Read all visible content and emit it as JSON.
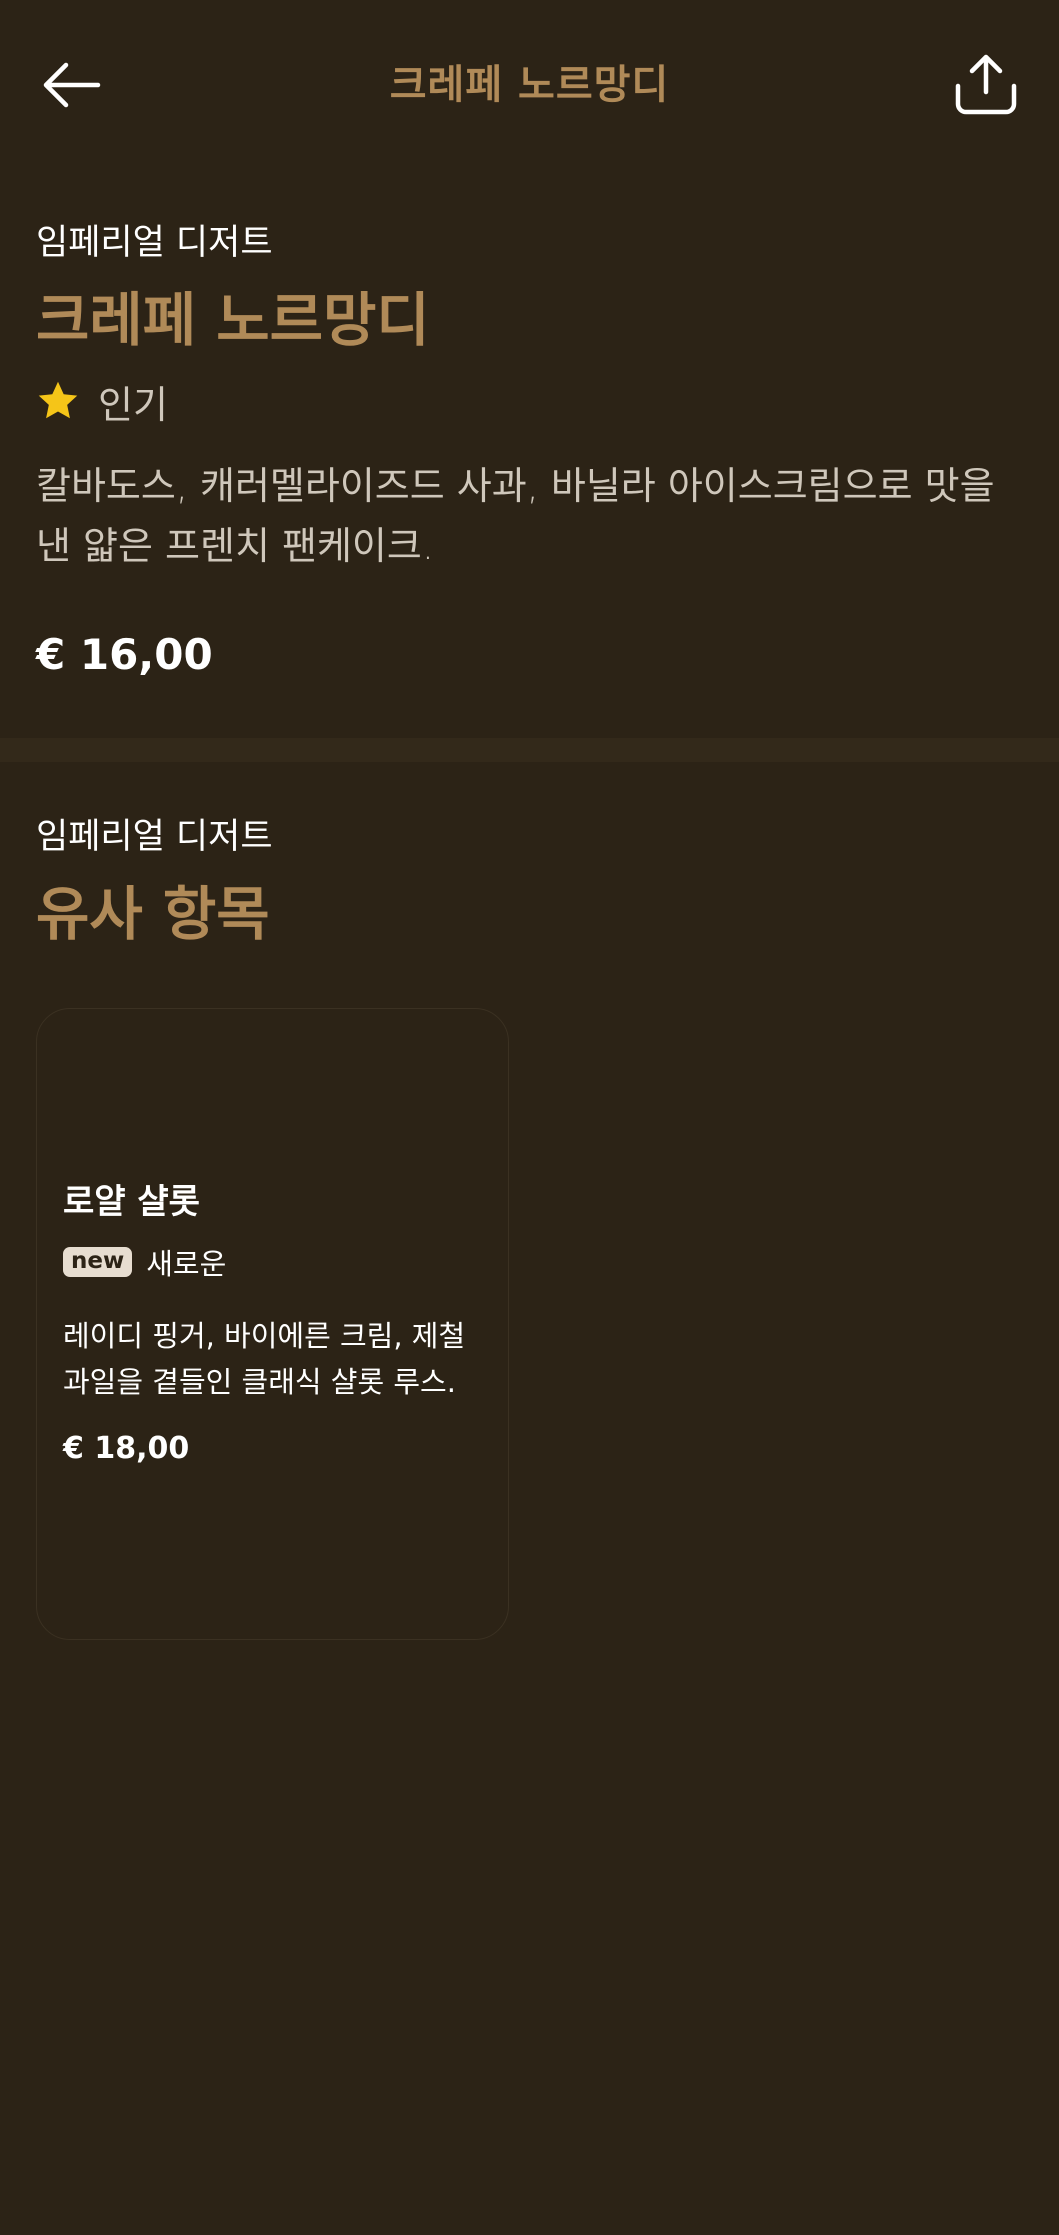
{
  "header": {
    "title": "크레페 노르망디",
    "back_icon": "arrow-left-icon",
    "share_icon": "share-icon"
  },
  "item": {
    "category": "임페리얼 디저트",
    "title": "크레페 노르망디",
    "tag": {
      "icon": "star-icon",
      "label": "인기"
    },
    "description": "칼바도스, 캐러멜라이즈드 사과, 바닐라 아이스크림으로 맛을 낸 얇은 프렌치 팬케이크.",
    "price": "€ 16,00"
  },
  "similar": {
    "category": "임페리얼 디저트",
    "title": "유사 항목",
    "items": [
      {
        "title": "로얄 샬롯",
        "badge": "new",
        "badge_label": "새로운",
        "description": "레이디 핑거, 바이에른 크림, 제철 과일을 곁들인 클래식 샬롯 루스.",
        "price": "€ 18,00"
      }
    ]
  },
  "colors": {
    "background": "#2c2316",
    "accent": "#b08a58",
    "star": "#f5c518",
    "divider": "#33291a"
  }
}
